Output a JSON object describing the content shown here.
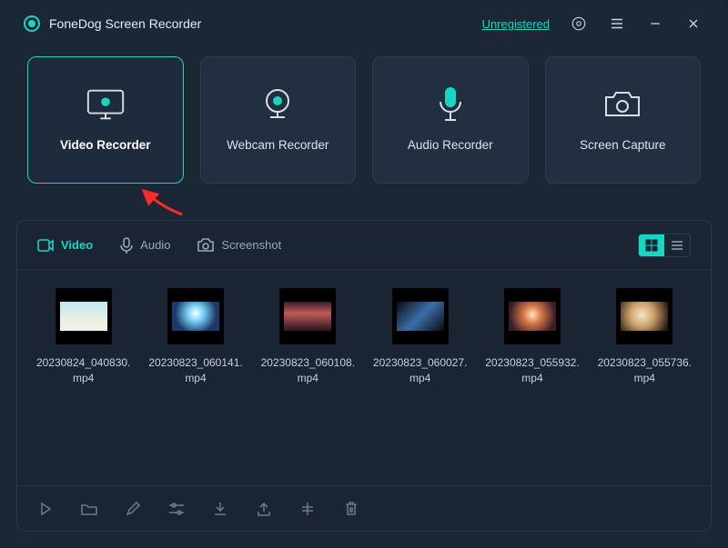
{
  "app": {
    "title": "FoneDog Screen Recorder"
  },
  "header": {
    "registration_status": "Unregistered"
  },
  "modes": [
    {
      "label": "Video Recorder",
      "active": true
    },
    {
      "label": "Webcam Recorder",
      "active": false
    },
    {
      "label": "Audio Recorder",
      "active": false
    },
    {
      "label": "Screen Capture",
      "active": false
    }
  ],
  "history": {
    "tabs": [
      {
        "label": "Video",
        "active": true
      },
      {
        "label": "Audio",
        "active": false
      },
      {
        "label": "Screenshot",
        "active": false
      }
    ],
    "view": "grid",
    "files": [
      {
        "name": "20230824_040830.mp4"
      },
      {
        "name": "20230823_060141.mp4"
      },
      {
        "name": "20230823_060108.mp4"
      },
      {
        "name": "20230823_060027.mp4"
      },
      {
        "name": "20230823_055932.mp4"
      },
      {
        "name": "20230823_055736.mp4"
      }
    ]
  },
  "colors": {
    "accent": "#19d6c2"
  }
}
